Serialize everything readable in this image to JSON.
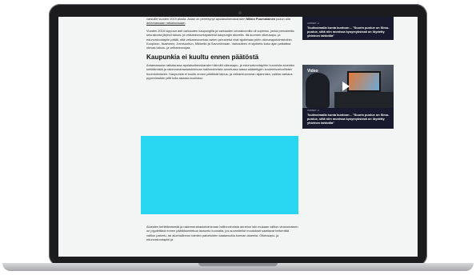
{
  "article": {
    "p1": "varsuille vuoden 2019 alusta. Asian on perehtynyt apulaisoikeuskansleri ",
    "p1_name": "Mikko Puumalainen",
    "p1_end": " joulun alla ",
    "p1_link": "antamassaan ratkaisussaan",
    "p2": "Vuoden 2018 loppuun asti varkauden kaupungilla ja varkauden seurakunnilla oli sopimus, jonka perusteella seurakunta järjesti talous- ja velkaneuvontapalvelut kaupungin alueella. Itä-suomen oikeusapu- ja edunvalvontapiiri päätti, että velkaneuvontaa varten perustetut virat sijoitetaan piirin oikeusaputoimistoihin Kuopioon, Iisalmeen, Joensuuhun, Mikkeliin ja Savonlinnaan. Varkauteen ei sijoitettu koko ajan palkattua olevaa talous- ja velkaneuvojaa.",
    "heading": "Kaupunkia ei kuultu ennen päätöstä",
    "p3": "Antamassaan ratkaisussa apulaisoikeuskansleri kiinnitti oikeusapu- ja edunvalvontapiirin huomiota alueiden kehittämistä ja rakennerahastotoiminnan hallinnoinnista annetussa laissa säädettyjen kuulemisvelvollisten huomioimiseen. Kaupunkia ei kuultu ennen päätöstä talous- ja velkaneuvonnan sijainnista, vaikka varkaus pyynnössään yritti tulla asiassa kuulluksi.",
    "p4": "Alueiden kehittämisestä ja rakennerahastotoiminnan hallinnoinnista annetun lain mukaan valtion viranomaisen on pyydettävä ennen päätöksentekoa lausunto kunnalta, jos suunnitellut muutokset saattavat heikentää valtion palvelu- tai aluehallinnon toimien palveluiden saatavuutta kunnan alueella. Oikeusapu- ja edunvalvontapiiri ja"
  },
  "sidebar": {
    "card1": {
      "meta": "UUTISET • 4",
      "title": "Tuulivoimalla kunta kuntoon – \"Suurin puolue on Simo-puolue, siitä niin monissa kysymyksissä on löydetty yhteinen tahtotila\""
    },
    "card2": {
      "video_label": "Video",
      "meta": "UUTISET • 4",
      "title": "Tuulivoimalla kunta kuntoon – \"Suurin puolue on Simo-puolue, siitä niin monissa kysymyksissä on löydetty yhteinen tahtotila\""
    }
  },
  "colors": {
    "ad_block": "#29d6f2",
    "card_bg": "#1a1a2e",
    "page_bg": "#f3f5f5"
  }
}
